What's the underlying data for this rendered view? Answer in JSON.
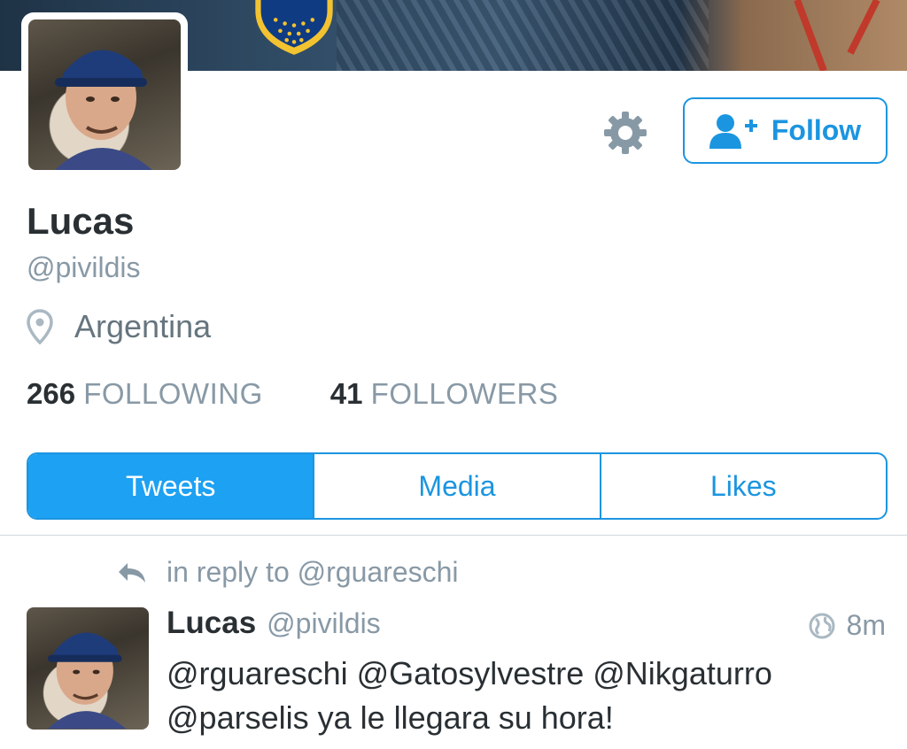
{
  "profile": {
    "name": "Lucas",
    "handle": "@pivildis",
    "location": "Argentina",
    "follow_label": "Follow"
  },
  "stats": {
    "following_count": "266",
    "following_label": "FOLLOWING",
    "followers_count": "41",
    "followers_label": "FOLLOWERS"
  },
  "tabs": [
    {
      "label": "Tweets",
      "active": true
    },
    {
      "label": "Media",
      "active": false
    },
    {
      "label": "Likes",
      "active": false
    }
  ],
  "tweet": {
    "reply_context": "in reply to @rguareschi",
    "name": "Lucas",
    "handle": "@pivildis",
    "time": "8m",
    "text": "@rguareschi @Gatosylvestre @Nikgaturro @parselis ya le llegara su hora!"
  },
  "icons": {
    "settings": "gear-icon",
    "follow": "add-user-icon",
    "location": "location-pin-icon",
    "reply": "reply-arrow-icon",
    "globe": "globe-icon"
  },
  "colors": {
    "accent": "#1DA1F2",
    "accent_border": "#1B95E0",
    "text_primary": "#292F33",
    "text_secondary": "#8899A6"
  }
}
